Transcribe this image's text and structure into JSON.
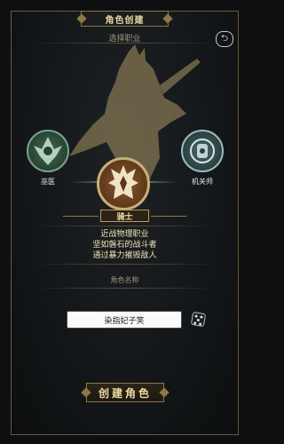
{
  "header": {
    "title": "角色创建",
    "subtitle": "选择职业",
    "back_icon": "back-arrow-icon"
  },
  "classes": {
    "left": {
      "label": "巫医",
      "icon": "green-rune-icon",
      "color": "#3f6a4b"
    },
    "right": {
      "label": "机关师",
      "icon": "teal-rune-icon",
      "color": "#486a6c"
    },
    "selected": {
      "label": "骑士",
      "icon": "knight-crest-icon",
      "color": "#8a5a2f",
      "description": [
        "近战物理职业",
        "坚如磐石的战斗者",
        "通过暴力摧毁敌人"
      ]
    }
  },
  "name": {
    "label": "角色名称",
    "value": "染指妃子笑",
    "dice_icon": "dice-icon"
  },
  "actions": {
    "create_label": "创建角色"
  },
  "colors": {
    "accent": "#8b7747",
    "text_gold": "#f0dca3",
    "background": "#0d0f10"
  }
}
